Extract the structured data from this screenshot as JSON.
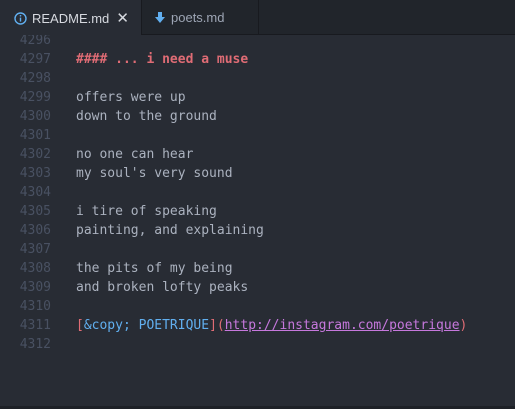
{
  "tabs": [
    {
      "label": "README.md",
      "icon": "info-icon",
      "active": true
    },
    {
      "label": "poets.md",
      "icon": "markdown-down-arrow-icon",
      "active": false
    }
  ],
  "editor": {
    "lines": [
      {
        "number": "4296",
        "text": ""
      },
      {
        "number": "4297",
        "text": "#### ... i need a muse"
      },
      {
        "number": "4298",
        "text": ""
      },
      {
        "number": "4299",
        "text": "offers were up"
      },
      {
        "number": "4300",
        "text": "down to the ground"
      },
      {
        "number": "4301",
        "text": ""
      },
      {
        "number": "4302",
        "text": "no one can hear"
      },
      {
        "number": "4303",
        "text": "my soul's very sound"
      },
      {
        "number": "4304",
        "text": ""
      },
      {
        "number": "4305",
        "text": "i tire of speaking"
      },
      {
        "number": "4306",
        "text": "painting, and explaining"
      },
      {
        "number": "4307",
        "text": ""
      },
      {
        "number": "4308",
        "text": "the pits of my being"
      },
      {
        "number": "4309",
        "text": "and broken lofty peaks"
      },
      {
        "number": "4310",
        "text": ""
      },
      {
        "number": "4311",
        "text": ""
      },
      {
        "number": "4312",
        "text": ""
      }
    ],
    "link": {
      "open_bracket": "[",
      "text": "&copy; POETRIQUE",
      "close_bracket": "]",
      "open_paren": "(",
      "url": "http://instagram.com/poetrique",
      "close_paren": ")"
    }
  },
  "colors": {
    "background": "#282c34",
    "tabbar": "#21252b",
    "heading": "#e06c75",
    "link_text": "#61afef",
    "url": "#c678dd",
    "text": "#abb2bf",
    "line_number": "#495162"
  }
}
